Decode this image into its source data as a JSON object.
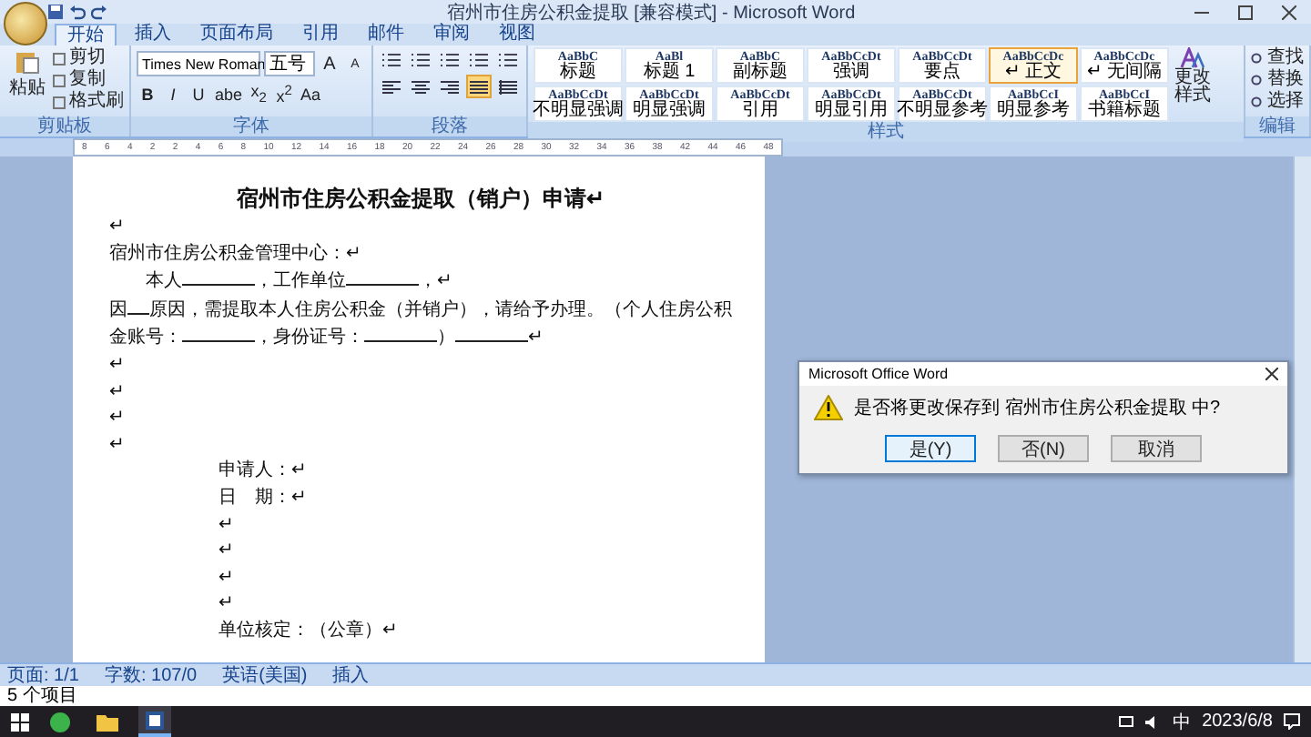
{
  "window": {
    "title": "宿州市住房公积金提取 [兼容模式] - Microsoft Word"
  },
  "tabs": [
    {
      "label": "开始",
      "selected": true
    },
    {
      "label": "插入",
      "selected": false
    },
    {
      "label": "页面布局",
      "selected": false
    },
    {
      "label": "引用",
      "selected": false
    },
    {
      "label": "邮件",
      "selected": false
    },
    {
      "label": "审阅",
      "selected": false
    },
    {
      "label": "视图",
      "selected": false
    }
  ],
  "clipboard": {
    "paste": "粘贴",
    "items": [
      "剪切",
      "复制",
      "格式刷"
    ],
    "group": "剪贴板"
  },
  "font": {
    "name": "Times New Roman",
    "size": "五号",
    "grow": "A",
    "shrink": "A",
    "buttons": [
      "**B**",
      "*I*",
      "U",
      "abe",
      "x$_{2}$",
      "x$^{2}$",
      "Aa"
    ],
    "group": "字体"
  },
  "paragraph": {
    "group": "段落",
    "align": [
      {
        "kind": "left",
        "selected": false
      },
      {
        "kind": "center",
        "selected": false
      },
      {
        "kind": "right",
        "selected": false
      },
      {
        "kind": "justify",
        "selected": true
      },
      {
        "kind": "distribute",
        "selected": false
      }
    ]
  },
  "styles": {
    "group": "样式",
    "change": "更改样式",
    "items": [
      {
        "sample": "AaBbC",
        "label": "标题",
        "selected": false
      },
      {
        "sample": "AaBl",
        "label": "标题 1",
        "selected": false
      },
      {
        "sample": "AaBbC",
        "label": "副标题",
        "selected": false
      },
      {
        "sample": "AaBbCcDt",
        "label": "强调",
        "selected": false
      },
      {
        "sample": "AaBbCcDt",
        "label": "要点",
        "selected": false
      },
      {
        "sample": "AaBbCcDc",
        "label": "↵ 正文",
        "selected": true
      },
      {
        "sample": "AaBbCcDc",
        "label": "↵ 无间隔",
        "selected": false
      },
      {
        "sample": "AaBbCcDt",
        "label": "不明显强调",
        "selected": false
      },
      {
        "sample": "AaBbCcDt",
        "label": "明显强调",
        "selected": false
      },
      {
        "sample": "AaBbCcDt",
        "label": "引用",
        "selected": false
      },
      {
        "sample": "AaBbCcDt",
        "label": "明显引用",
        "selected": false
      },
      {
        "sample": "AaBbCcDt",
        "label": "不明显参考",
        "selected": false
      },
      {
        "sample": "AaBbCcI",
        "label": "明显参考",
        "selected": false
      },
      {
        "sample": "AaBbCcI",
        "label": "书籍标题",
        "selected": false
      }
    ]
  },
  "editing": {
    "group": "编辑",
    "items": [
      "查找",
      "替换",
      "选择"
    ]
  },
  "ruler": {
    "labels": [
      "8",
      "6",
      "4",
      "2",
      "2",
      "4",
      "6",
      "8",
      "10",
      "12",
      "14",
      "16",
      "18",
      "20",
      "22",
      "24",
      "26",
      "28",
      "30",
      "32",
      "34",
      "36",
      "38",
      "42",
      "44",
      "46",
      "48"
    ]
  },
  "document": {
    "lines": [
      {
        "kind": "title",
        "parts": [
          {
            "kind": "text",
            "text": "宿州市住房公积金提取（销户）申请↵"
          }
        ]
      },
      {
        "kind": "para",
        "parts": [
          {
            "kind": "text",
            "text": "↵"
          }
        ]
      },
      {
        "kind": "para",
        "parts": [
          {
            "kind": "text",
            "text": "宿州市住房公积金管理中心：↵"
          }
        ]
      },
      {
        "kind": "indent",
        "parts": [
          {
            "kind": "text",
            "text": "本人"
          },
          {
            "kind": "blank"
          },
          {
            "kind": "text",
            "text": "，工作单位"
          },
          {
            "kind": "blank"
          },
          {
            "kind": "text",
            "text": "，↵"
          }
        ]
      },
      {
        "kind": "para",
        "parts": [
          {
            "kind": "text",
            "text": "因"
          },
          {
            "kind": "blank"
          },
          {
            "kind": "text",
            "text": "原因，需提取本人住房公积金（并销户），请给予办理。（个人住房公积"
          }
        ]
      },
      {
        "kind": "para",
        "parts": [
          {
            "kind": "text",
            "text": "金账号："
          },
          {
            "kind": "blank"
          },
          {
            "kind": "text",
            "text": "，身份证号："
          },
          {
            "kind": "blank"
          },
          {
            "kind": "text",
            "text": "）"
          },
          {
            "kind": "blank"
          },
          {
            "kind": "text",
            "text": "↵"
          }
        ]
      },
      {
        "kind": "para",
        "parts": [
          {
            "kind": "text",
            "text": "↵"
          }
        ]
      },
      {
        "kind": "para",
        "parts": [
          {
            "kind": "text",
            "text": "↵"
          }
        ]
      },
      {
        "kind": "para",
        "parts": [
          {
            "kind": "text",
            "text": "↵"
          }
        ]
      },
      {
        "kind": "para",
        "parts": [
          {
            "kind": "text",
            "text": "↵"
          }
        ]
      },
      {
        "kind": "sign",
        "parts": [
          {
            "kind": "text",
            "text": "申请人：↵"
          }
        ]
      },
      {
        "kind": "sign",
        "parts": [
          {
            "kind": "text",
            "text": "日　期：↵"
          }
        ]
      },
      {
        "kind": "sign",
        "parts": [
          {
            "kind": "text",
            "text": "↵"
          }
        ]
      },
      {
        "kind": "sign",
        "parts": [
          {
            "kind": "text",
            "text": "↵"
          }
        ]
      },
      {
        "kind": "sign",
        "parts": [
          {
            "kind": "text",
            "text": "↵"
          }
        ]
      },
      {
        "kind": "sign",
        "parts": [
          {
            "kind": "text",
            "text": "↵"
          }
        ]
      },
      {
        "kind": "sign",
        "parts": [
          {
            "kind": "text",
            "text": "单位核定：（公章）↵"
          }
        ]
      }
    ]
  },
  "dialog": {
    "title": "Microsoft Office Word",
    "message": "是否将更改保存到 宿州市住房公积金提取 中?",
    "buttons": [
      {
        "label": "是(Y)",
        "selected": true
      },
      {
        "label": "否(N)",
        "selected": false
      },
      {
        "label": "取消",
        "selected": false
      }
    ]
  },
  "status_bar": {
    "items": [
      "页面: 1/1",
      "字数: 107/0",
      "英语(美国)",
      "插入"
    ]
  },
  "explorer": {
    "count": "5 个项目"
  },
  "taskbar": {
    "apps": [
      {
        "kind": "browser",
        "selected": false
      },
      {
        "kind": "folder",
        "selected": false
      },
      {
        "kind": "word",
        "selected": true
      }
    ],
    "ime": "中",
    "date": "2023/6/8"
  }
}
